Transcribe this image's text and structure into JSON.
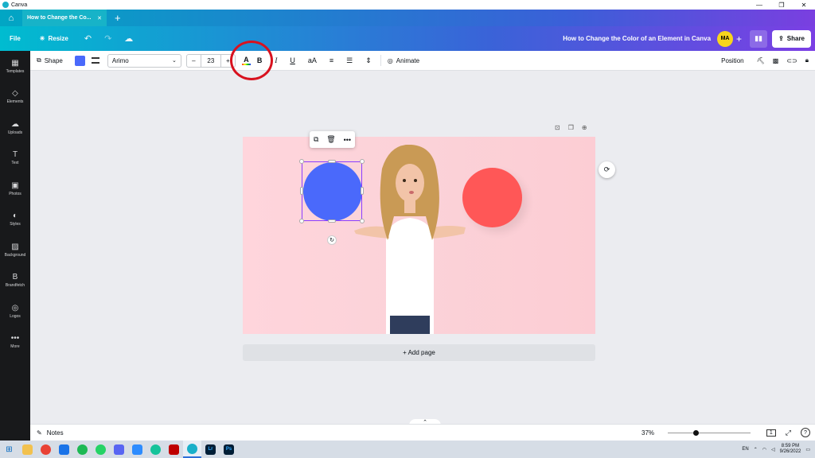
{
  "window": {
    "title": "Canva",
    "controls": [
      "—",
      "❐",
      "✕"
    ]
  },
  "tabs": {
    "home_icon": "home-icon",
    "active_tab": "How to Change the Co...",
    "close": "✕",
    "add": "+"
  },
  "header": {
    "file": "File",
    "resize": "Resize",
    "doc_title": "How to Change the Color of an Element in Canva",
    "avatar": "MA",
    "share": "Share"
  },
  "sidebar": {
    "items": [
      {
        "label": "Templates",
        "icon": "▦"
      },
      {
        "label": "Elements",
        "icon": "◇"
      },
      {
        "label": "Uploads",
        "icon": "☁"
      },
      {
        "label": "Text",
        "icon": "T"
      },
      {
        "label": "Photos",
        "icon": "▣"
      },
      {
        "label": "Styles",
        "icon": "◐"
      },
      {
        "label": "Background",
        "icon": "▨"
      },
      {
        "label": "Brandfetch",
        "icon": "B"
      },
      {
        "label": "Logos",
        "icon": "◎"
      },
      {
        "label": "More",
        "icon": "•••"
      }
    ]
  },
  "toolbar": {
    "shape": "Shape",
    "shape_color": "#4a69fb",
    "font": "Arimo",
    "font_size": "23",
    "minus": "–",
    "plus": "+",
    "text_color": "A",
    "bold": "B",
    "italic": "I",
    "underline": "U",
    "case": "aA",
    "animate": "Animate",
    "position": "Position"
  },
  "canvas": {
    "blue_color": "#4a69fb",
    "red_color": "#ff5757",
    "add_page": "+ Add page"
  },
  "bottom": {
    "notes": "Notes",
    "zoom": "37%",
    "zoom_fraction": 0.37,
    "page": "1",
    "help": "?"
  },
  "taskbar": {
    "lang": "EN",
    "time": "8:59 PM",
    "date": "9/26/2022",
    "apps": [
      "Lr",
      "Ps"
    ]
  }
}
